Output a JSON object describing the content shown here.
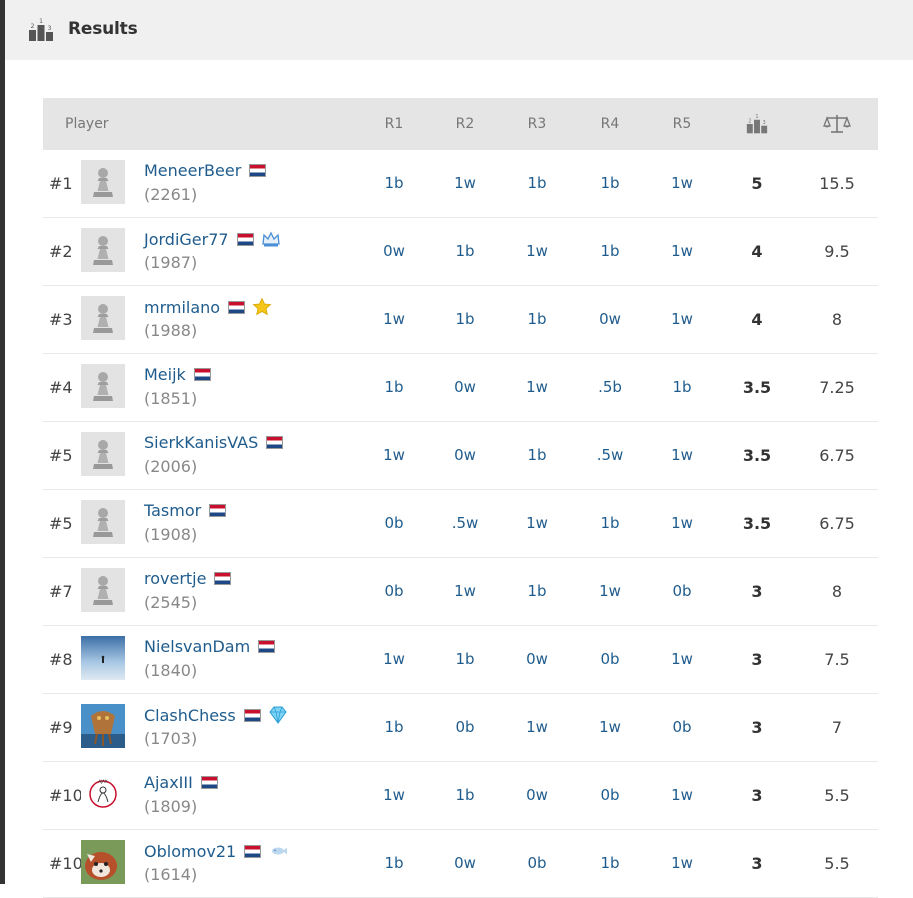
{
  "header": {
    "title": "Results",
    "icon": "podium-icon"
  },
  "table": {
    "columns": {
      "player": "Player",
      "r1": "R1",
      "r2": "R2",
      "r3": "R3",
      "r4": "R4",
      "r5": "R5",
      "points_icon": "podium-icon",
      "tiebreak_icon": "scale-icon"
    },
    "rows": [
      {
        "rank": "#1",
        "name": "MeneerBeer",
        "rating": "(2261)",
        "avatar": "pawn",
        "badge": "",
        "results": [
          "1b",
          "1w",
          "1b",
          "1b",
          "1w"
        ],
        "points": "5",
        "tiebreak": "15.5"
      },
      {
        "rank": "#2",
        "name": "JordiGer77",
        "rating": "(1987)",
        "avatar": "pawn",
        "badge": "crown-icon",
        "results": [
          "0w",
          "1b",
          "1w",
          "1b",
          "1w"
        ],
        "points": "4",
        "tiebreak": "9.5"
      },
      {
        "rank": "#3",
        "name": "mrmilano",
        "rating": "(1988)",
        "avatar": "pawn",
        "badge": "star-icon",
        "results": [
          "1w",
          "1b",
          "1b",
          "0w",
          "1w"
        ],
        "points": "4",
        "tiebreak": "8"
      },
      {
        "rank": "#4",
        "name": "Meijk",
        "rating": "(1851)",
        "avatar": "pawn",
        "badge": "",
        "results": [
          "1b",
          "0w",
          "1w",
          ".5b",
          "1b"
        ],
        "points": "3.5",
        "tiebreak": "7.25"
      },
      {
        "rank": "#5",
        "name": "SierkKanisVAS",
        "rating": "(2006)",
        "avatar": "pawn",
        "badge": "",
        "results": [
          "1w",
          "0w",
          "1b",
          ".5w",
          "1w"
        ],
        "points": "3.5",
        "tiebreak": "6.75"
      },
      {
        "rank": "#5",
        "name": "Tasmor",
        "rating": "(1908)",
        "avatar": "pawn",
        "badge": "",
        "results": [
          "0b",
          ".5w",
          "1w",
          "1b",
          "1w"
        ],
        "points": "3.5",
        "tiebreak": "6.75"
      },
      {
        "rank": "#7",
        "name": "rovertje",
        "rating": "(2545)",
        "avatar": "pawn",
        "badge": "",
        "results": [
          "0b",
          "1w",
          "1b",
          "1w",
          "0b"
        ],
        "points": "3",
        "tiebreak": "8"
      },
      {
        "rank": "#8",
        "name": "NielsvanDam",
        "rating": "(1840)",
        "avatar": "sky-photo",
        "badge": "",
        "results": [
          "1w",
          "1b",
          "0w",
          "0b",
          "1w"
        ],
        "points": "3",
        "tiebreak": "7.5"
      },
      {
        "rank": "#9",
        "name": "ClashChess",
        "rating": "(1703)",
        "avatar": "sea-photo",
        "badge": "diamond-icon",
        "results": [
          "1b",
          "0b",
          "1w",
          "1w",
          "0b"
        ],
        "points": "3",
        "tiebreak": "7"
      },
      {
        "rank": "#10",
        "name": "AjaxIII",
        "rating": "(1809)",
        "avatar": "ajax-logo",
        "badge": "",
        "results": [
          "1w",
          "1b",
          "0w",
          "0b",
          "1w"
        ],
        "points": "3",
        "tiebreak": "5.5"
      },
      {
        "rank": "#10",
        "name": "Oblomov21",
        "rating": "(1614)",
        "avatar": "red-panda-photo",
        "badge": "fish-icon",
        "results": [
          "1b",
          "0w",
          "0b",
          "1b",
          "1w"
        ],
        "points": "3",
        "tiebreak": "5.5"
      }
    ]
  },
  "colors": {
    "link": "#1f5c8d",
    "header_bg": "#f0f0f0",
    "thead_bg": "#e5e5e5"
  }
}
